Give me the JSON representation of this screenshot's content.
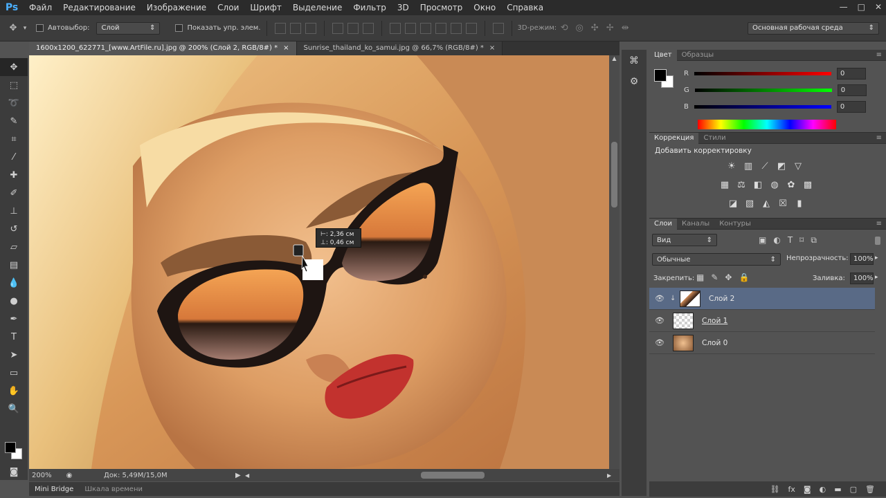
{
  "app": {
    "logo": "Ps"
  },
  "menu": [
    "Файл",
    "Редактирование",
    "Изображение",
    "Слои",
    "Шрифт",
    "Выделение",
    "Фильтр",
    "3D",
    "Просмотр",
    "Окно",
    "Справка"
  ],
  "window_controls": [
    "—",
    "□",
    "✕"
  ],
  "options": {
    "autoselect_label": "Автовыбор:",
    "autoselect_value": "Слой",
    "show_controls_label": "Показать упр. элем.",
    "mode3d_label": "3D-режим:",
    "workspace_value": "Основная рабочая среда"
  },
  "doc_tabs": [
    {
      "label": "1600x1200_622771_[www.ArtFile.ru].jpg @ 200% (Слой 2, RGB/8#) *",
      "close": "×"
    },
    {
      "label": "Sunrise_thailand_ko_samui.jpg @ 66,7% (RGB/8#) *",
      "close": "×"
    }
  ],
  "tooltip": {
    "line1": "⊢: 2,36 см",
    "line2": "⊥: 0,46 см"
  },
  "status": {
    "zoom": "200%",
    "doc": "Док: 5,49M/15,0M"
  },
  "bottom_tabs": [
    "Mini Bridge",
    "Шкала времени"
  ],
  "color_panel": {
    "tabs": [
      "Цвет",
      "Образцы"
    ],
    "r_label": "R",
    "r_value": "0",
    "g_label": "G",
    "g_value": "0",
    "b_label": "B",
    "b_value": "0"
  },
  "adjustments_panel": {
    "tabs": [
      "Коррекция",
      "Стили"
    ],
    "title": "Добавить корректировку"
  },
  "layers_panel": {
    "tabs": [
      "Слои",
      "Каналы",
      "Контуры"
    ],
    "filter_value": "Вид",
    "blend_value": "Обычные",
    "opacity_label": "Непрозрачность:",
    "opacity_value": "100%",
    "lock_label": "Закрепить:",
    "fill_label": "Заливка:",
    "fill_value": "100%",
    "layers": [
      {
        "name": "Слой 2",
        "active": true
      },
      {
        "name": "Слой 1",
        "active": false
      },
      {
        "name": "Слой 0",
        "active": false
      }
    ]
  },
  "colors": {
    "accent_ps": "#4ab0ff",
    "selected_layer": "#596a86"
  }
}
